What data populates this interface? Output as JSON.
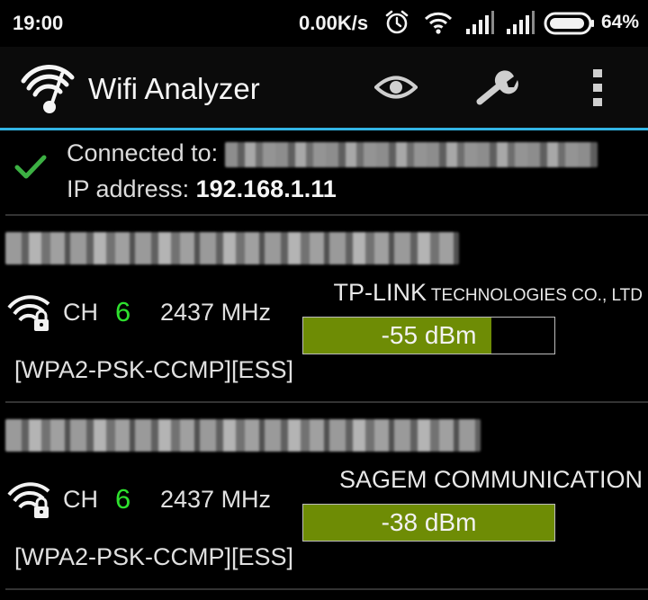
{
  "status_bar": {
    "time": "19:00",
    "net_speed": "0.00K/s",
    "battery": "64%",
    "battery_level": 0.64,
    "icons": [
      "alarm-icon",
      "wifi-icon",
      "signal-icon",
      "signal-icon",
      "battery-icon"
    ]
  },
  "app_bar": {
    "title": "Wifi Analyzer",
    "icons": [
      "app-logo-icon",
      "eye-icon",
      "wrench-icon",
      "overflow-menu-icon"
    ]
  },
  "connection": {
    "connected_label": "Connected to: ",
    "ip_label": "IP address: ",
    "ip_value": "192.168.1.11"
  },
  "networks": [
    {
      "channel_label": "CH",
      "channel": "6",
      "frequency": "2437 MHz",
      "vendor_big": "TP-LINK",
      "vendor_small": " TECHNOLOGIES CO., LTD",
      "signal": "-55 dBm",
      "signal_level": 0.75,
      "capabilities": "[WPA2-PSK-CCMP][ESS]"
    },
    {
      "channel_label": "CH",
      "channel": "6",
      "frequency": "2437 MHz",
      "vendor_big": "SAGEM COMMUNICATION",
      "vendor_small": "",
      "signal": "-38 dBm",
      "signal_level": 1.0,
      "capabilities": "[WPA2-PSK-CCMP][ESS]"
    }
  ],
  "colors": {
    "accent": "#33b5e5",
    "channel": "#2ee02e",
    "signal_fill": "#6e8c05",
    "check": "#3cb043"
  }
}
